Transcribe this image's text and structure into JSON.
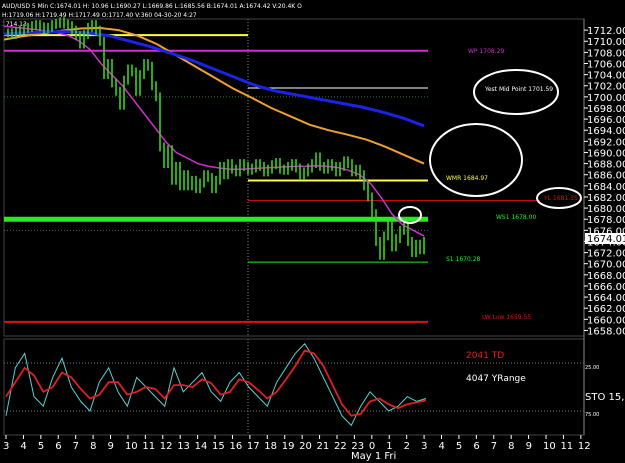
{
  "header": {
    "symbol": "AUD/USD 5 Min",
    "quote": "C:1674.01 H: 10.96 L:1690.27 L:1669.86 L:1685.56 B:1674.01 A:1674.42 V:20.4K O",
    "ohlc2": "H:1719.06 H:1719.49 H:1717.49 O:1717.40 V:360 04-30-20 4:27",
    "level": "1714.13"
  },
  "axes": {
    "y_ticks": [
      1712,
      1710,
      1708,
      1706,
      1704,
      1702,
      1700,
      1698,
      1696,
      1694,
      1692,
      1690,
      1688,
      1686,
      1684,
      1682,
      1680,
      1678,
      1676,
      1674,
      1672,
      1670,
      1668,
      1666,
      1664,
      1662,
      1660,
      1658
    ],
    "y_tick_labels": [
      "1712.00",
      "1710.00",
      "1708.00",
      "1706.00",
      "1704.00",
      "1702.00",
      "1700.00",
      "1698.00",
      "1696.00",
      "1694.00",
      "1692.00",
      "1690.00",
      "1688.00",
      "1686.00",
      "1684.00",
      "1682.00",
      "1680.00",
      "1678.00",
      "1676.00",
      "1674.00",
      "1672.00",
      "1670.00",
      "1668.00",
      "1666.00",
      "1664.00",
      "1662.00",
      "1660.00",
      "1658.00"
    ],
    "x_tick_labels": [
      "3",
      "4",
      "5",
      "6",
      "7",
      "8",
      "9",
      "10",
      "11",
      "12",
      "13",
      "14",
      "15",
      "16",
      "17",
      "18",
      "19",
      "20",
      "21",
      "22",
      "23",
      "0",
      "1",
      "2",
      "3",
      "4",
      "5",
      "6",
      "7",
      "8",
      "9",
      "10",
      "11",
      "12"
    ],
    "date_label": "May 1 Fri",
    "current_price": "1674.01",
    "osc_y_labels": [
      "25.00",
      "75.00"
    ]
  },
  "levels": {
    "wp_label": "WP 1708.29",
    "yest_mid_label": "Yest Mid Point 1701.59",
    "wmr_label": "WMR 1684.97",
    "yl_label": "YL 1681.35",
    "ws1_label": "WS1 1678.00",
    "s1_label": "S1 1670.28",
    "lw_label": "LW Low 1659.55"
  },
  "oscillator": {
    "td_label": "2041 TD",
    "yrange_label": "4047 YRange",
    "sto_label": "STO 15,"
  },
  "colors": {
    "background": "#000000",
    "price": "#39d31c",
    "magenta_ma": "#d22ed3",
    "orange_ma": "#f0a030",
    "blue_ma": "#1b24e6",
    "yellow_line": "#ffff40",
    "green_line": "#22ee22",
    "red_line": "#e01010",
    "white_line": "#ffffff",
    "sto_red": "#e02020",
    "sto_cyan": "#59d1d1"
  },
  "chart_data": {
    "type": "line",
    "title": "AUD/USD 5 Min",
    "ylim": [
      1657,
      1714
    ],
    "x": [
      2,
      4,
      6,
      8,
      10,
      12,
      14,
      16,
      18,
      20,
      22,
      24,
      26,
      28,
      30,
      32,
      34,
      36,
      38,
      40,
      42,
      44,
      46,
      48,
      50,
      52,
      54,
      56,
      58,
      60,
      62,
      64,
      66,
      68,
      70,
      72,
      74,
      76,
      78,
      80,
      82,
      84,
      86,
      88,
      90,
      92,
      94,
      96,
      98,
      100,
      102,
      104,
      106,
      108,
      110,
      112,
      114,
      116,
      118,
      120,
      122,
      124,
      126,
      128,
      130,
      132,
      134,
      136,
      138,
      140,
      142,
      144,
      146,
      148,
      150,
      152,
      154,
      156,
      158,
      160,
      162,
      164,
      166,
      168,
      170,
      172,
      174,
      176,
      178,
      180,
      182,
      184,
      186,
      188,
      190,
      192,
      194,
      196,
      198,
      200,
      202,
      204,
      206,
      208,
      210
    ],
    "series": [
      {
        "values": [
          1711.5,
          1711.2,
          1711.8,
          1712.0,
          1712.3,
          1712.5,
          1712.8,
          1713.0,
          1712.6,
          1712.2,
          1712.5,
          1713.0,
          1713.2,
          1713.5,
          1713.1,
          1712.8,
          1712.0,
          1711.0,
          1709.5,
          1711.2,
          1712.5,
          1713.0,
          1712.0,
          1710.0,
          1704.0,
          1706.0,
          1702.5,
          1701.0,
          1698.5,
          1703.0,
          1705.0,
          1704.5,
          1701.0,
          1704.0,
          1706.0,
          1705.5,
          1702.0,
          1700.0,
          1691.0,
          1688.0,
          1690.5,
          1685.0,
          1687.5,
          1684.0,
          1686.0,
          1684.0,
          1685.0,
          1683.5,
          1684.5,
          1686.0,
          1685.5,
          1683.5,
          1685.0,
          1687.5,
          1686.0,
          1688.0,
          1687.0,
          1686.5,
          1688.0,
          1687.5,
          1686.8,
          1687.2,
          1688.0,
          1687.5,
          1686.5,
          1687.0,
          1687.8,
          1688.2,
          1687.0,
          1686.8,
          1687.5,
          1688.0,
          1687.2,
          1686.0,
          1686.5,
          1687.2,
          1688.0,
          1689.2,
          1687.5,
          1687.0,
          1688.0,
          1687.5,
          1686.5,
          1687.5,
          1688.5,
          1688.0,
          1686.5,
          1687.0,
          1686.0,
          1684.0,
          1682.0,
          1679.0,
          1674.0,
          1671.5,
          1675.0,
          1677.0,
          1673.0,
          1674.5,
          1676.0,
          1677.5,
          1674.0,
          1672.0,
          1673.5,
          1672.5,
          1674.0
        ]
      },
      {
        "values": [
          1712.7,
          1712.5,
          1712.3,
          1712.1,
          1711.8,
          1711.5,
          1711.0,
          1710.0,
          1708.5,
          1706.0,
          1704.0,
          1702.0,
          1699.5,
          1697.0,
          1694.5,
          1692.0,
          1690.0,
          1689.0,
          1688.0,
          1687.5,
          1687.2,
          1687.0,
          1687.0,
          1687.1,
          1687.2,
          1687.3,
          1687.4,
          1687.5,
          1687.5,
          1687.6,
          1687.5,
          1687.3,
          1686.8,
          1686.0,
          1684.5,
          1682.0,
          1679.0,
          1677.0,
          1676.0,
          1675.0
        ]
      },
      {
        "values": [
          1710.3,
          1710.9,
          1711.4,
          1711.9,
          1712.3,
          1712.4,
          1712.0,
          1711.0,
          1709.5,
          1707.5,
          1705.5,
          1703.5,
          1701.5,
          1699.8,
          1698.0,
          1696.5,
          1695.0,
          1694.0,
          1693.2,
          1692.3,
          1691.0,
          1689.5,
          1688.0
        ]
      },
      {
        "values": [
          1711.3,
          1711.5,
          1711.7,
          1711.7,
          1711.5,
          1711.0,
          1710.0,
          1709.0,
          1707.8,
          1706.5,
          1705.0,
          1703.5,
          1702.0,
          1701.0,
          1700.3,
          1699.6,
          1698.9,
          1698.2,
          1697.3,
          1696.2,
          1694.8
        ]
      }
    ],
    "horizontal_levels": [
      1711.1,
      1708.3,
      1701.6,
      1684.97,
      1681.35,
      1678.0,
      1670.28,
      1659.55
    ],
    "oscillator": {
      "ylim": [
        0,
        100
      ],
      "ticks": [
        25,
        75
      ],
      "k": [
        20,
        70,
        85,
        40,
        30,
        60,
        80,
        50,
        35,
        25,
        55,
        70,
        45,
        30,
        60,
        50,
        40,
        30,
        70,
        45,
        55,
        65,
        45,
        35,
        55,
        65,
        50,
        40,
        30,
        55,
        70,
        85,
        95,
        80,
        60,
        40,
        20,
        10,
        30,
        45,
        35,
        25,
        30,
        40,
        35,
        38
      ],
      "d": [
        40,
        55,
        70,
        62,
        45,
        50,
        65,
        60,
        48,
        38,
        42,
        55,
        55,
        42,
        45,
        50,
        48,
        38,
        52,
        52,
        50,
        58,
        54,
        42,
        45,
        58,
        55,
        47,
        38,
        45,
        58,
        72,
        88,
        85,
        72,
        52,
        32,
        20,
        22,
        35,
        38,
        32,
        28,
        32,
        34,
        36
      ]
    }
  }
}
